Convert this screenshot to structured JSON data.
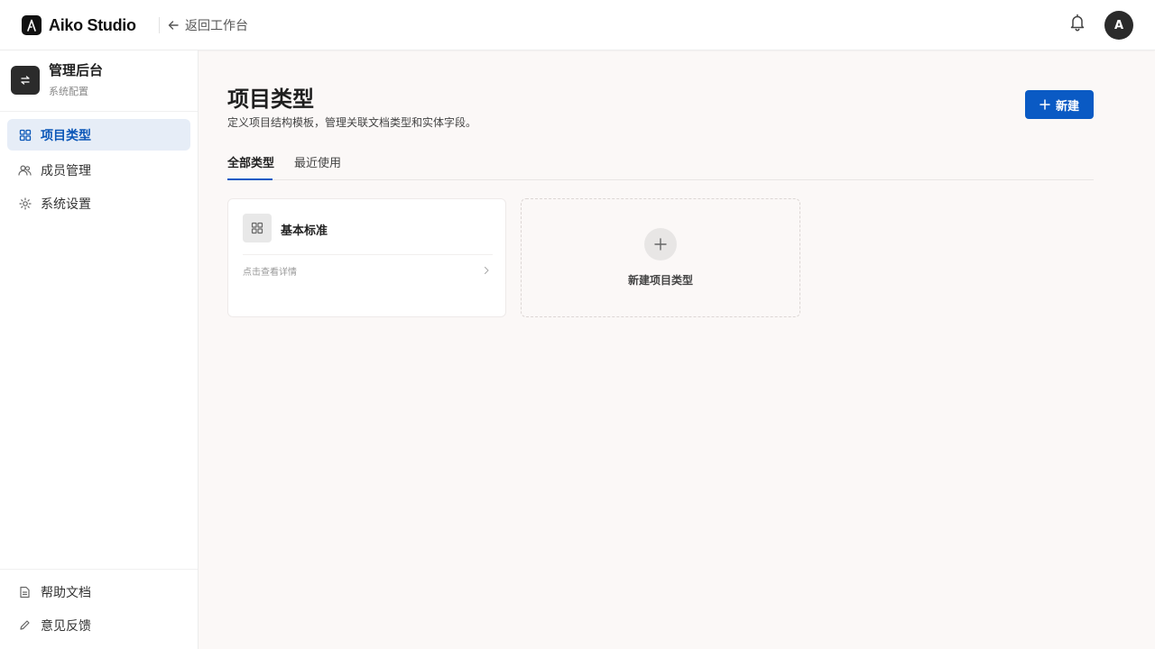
{
  "app": {
    "name": "Aiko Studio",
    "back_label": "返回工作台",
    "avatar_initial": "A"
  },
  "sidebar": {
    "title": "管理后台",
    "subtitle": "系统配置",
    "items": [
      {
        "label": "项目类型",
        "icon": "grid-icon",
        "active": true
      },
      {
        "label": "成员管理",
        "icon": "users-icon",
        "active": false
      },
      {
        "label": "系统设置",
        "icon": "gear-icon",
        "active": false
      }
    ],
    "bottom_items": [
      {
        "label": "帮助文档",
        "icon": "document-icon"
      },
      {
        "label": "意见反馈",
        "icon": "pencil-icon"
      }
    ]
  },
  "main": {
    "title": "项目类型",
    "description": "定义项目结构模板，管理关联文档类型和实体字段。",
    "new_button_label": "新建",
    "tabs": [
      {
        "label": "全部类型",
        "active": true
      },
      {
        "label": "最近使用",
        "active": false
      }
    ],
    "cards": [
      {
        "title": "基本标准",
        "link_label": "点击查看详情"
      }
    ],
    "new_card_label": "新建项目类型"
  },
  "colors": {
    "accent": "#0a5ac4",
    "active_nav_bg": "#e6edf7",
    "background": "#fbf8f7"
  }
}
